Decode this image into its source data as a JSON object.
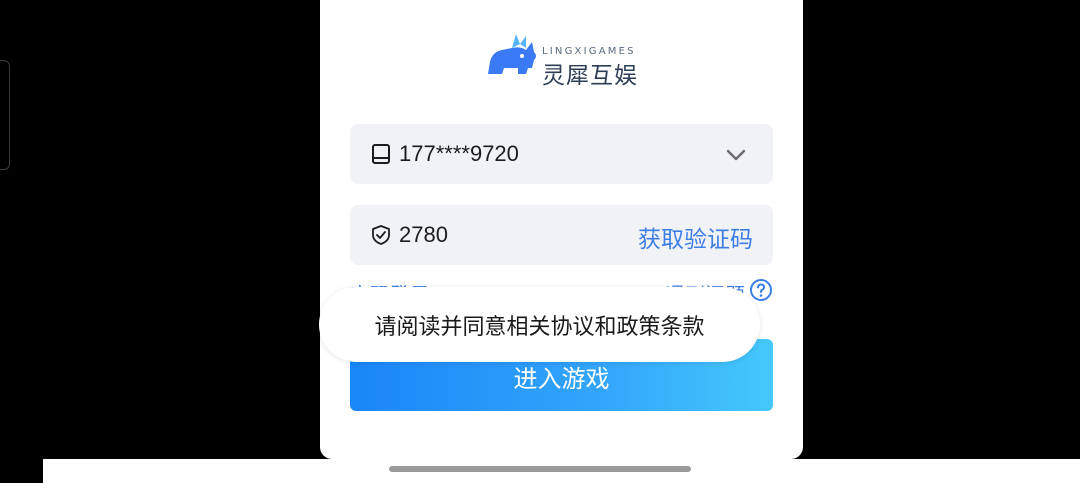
{
  "brand": {
    "logo_small": "LINGXIGAMES",
    "logo_main": "灵犀互娱",
    "logo_color": "#3a7bf5"
  },
  "login": {
    "phone_value": "177****9720",
    "phone_icon": "tablet-icon",
    "dropdown_icon": "chevron-down-icon",
    "code_value": "2780",
    "code_icon": "shield-check-icon",
    "get_code_label": "获取验证码",
    "left_link_partial": "密码登录",
    "right_link_partial": "遇到问题",
    "help_icon": "question-circle-icon",
    "enter_button_label": "进入游戏"
  },
  "toast": {
    "message": "请阅读并同意相关协议和政策条款"
  },
  "colors": {
    "accent": "#3d7ee6",
    "button_gradient_start": "#1a86f7",
    "button_gradient_end": "#45c8fb",
    "field_bg": "#f1f2f6"
  }
}
